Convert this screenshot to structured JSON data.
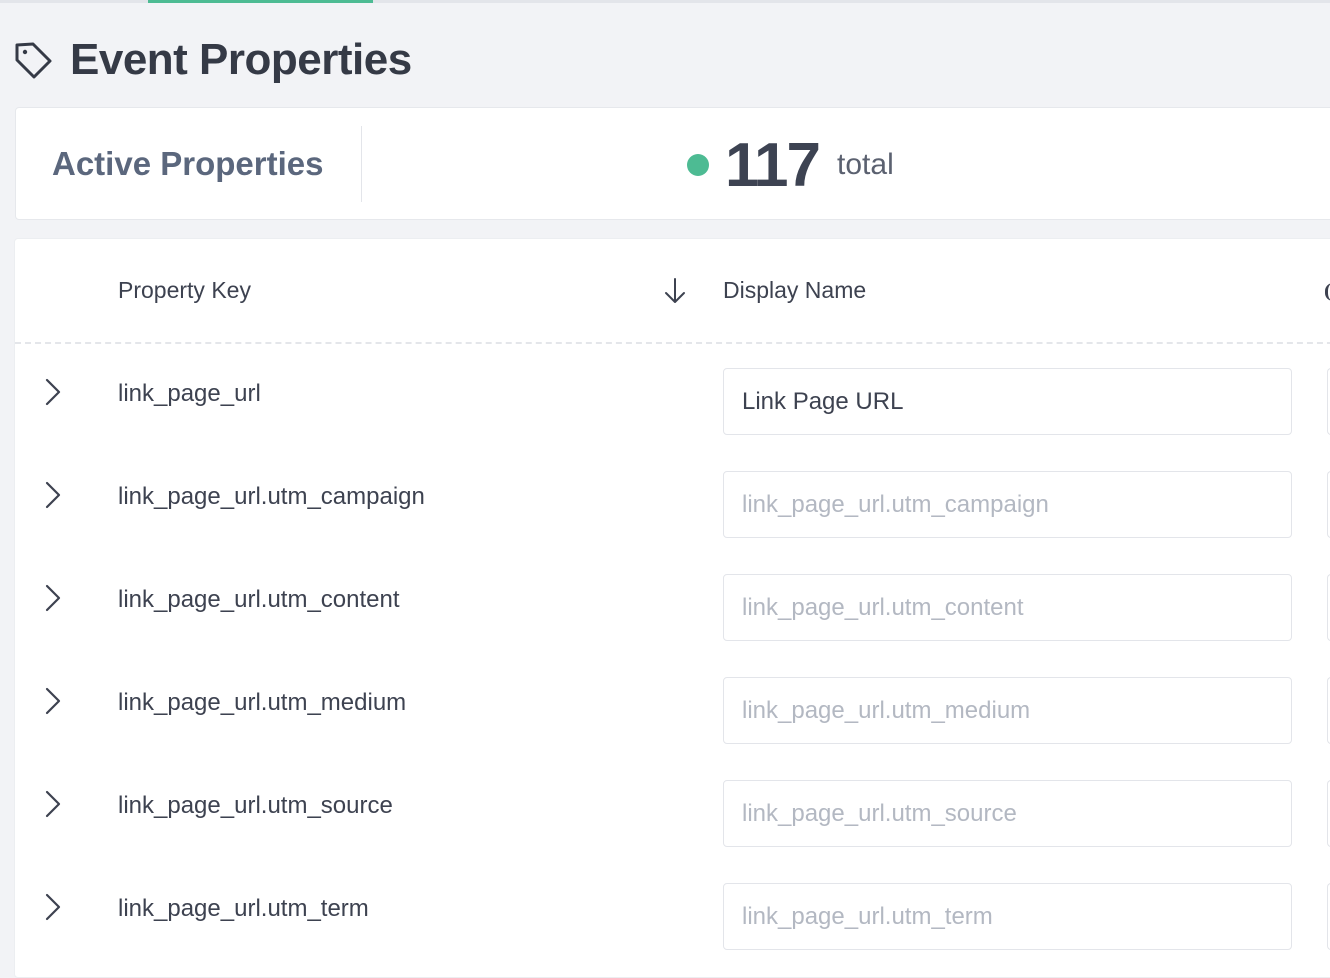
{
  "header": {
    "title": "Event Properties",
    "icon": "tag-icon"
  },
  "stats": {
    "label": "Active Properties",
    "count": "117",
    "suffix": "total",
    "status_color": "#4dbb93"
  },
  "table": {
    "columns": {
      "key": "Property Key",
      "display": "Display Name"
    },
    "sort": {
      "column": "key",
      "direction": "descending",
      "icon": "arrow-down-icon"
    },
    "rows": [
      {
        "key": "link_page_url",
        "display_value": "Link Page URL",
        "placeholder": "link_page_url"
      },
      {
        "key": "link_page_url.utm_campaign",
        "display_value": "",
        "placeholder": "link_page_url.utm_campaign"
      },
      {
        "key": "link_page_url.utm_content",
        "display_value": "",
        "placeholder": "link_page_url.utm_content"
      },
      {
        "key": "link_page_url.utm_medium",
        "display_value": "",
        "placeholder": "link_page_url.utm_medium"
      },
      {
        "key": "link_page_url.utm_source",
        "display_value": "",
        "placeholder": "link_page_url.utm_source"
      },
      {
        "key": "link_page_url.utm_term",
        "display_value": "",
        "placeholder": "link_page_url.utm_term"
      }
    ]
  },
  "colors": {
    "accent": "#4dbb93",
    "background": "#f2f3f6",
    "text": "#3d4250",
    "placeholder": "#b3b8c2"
  }
}
